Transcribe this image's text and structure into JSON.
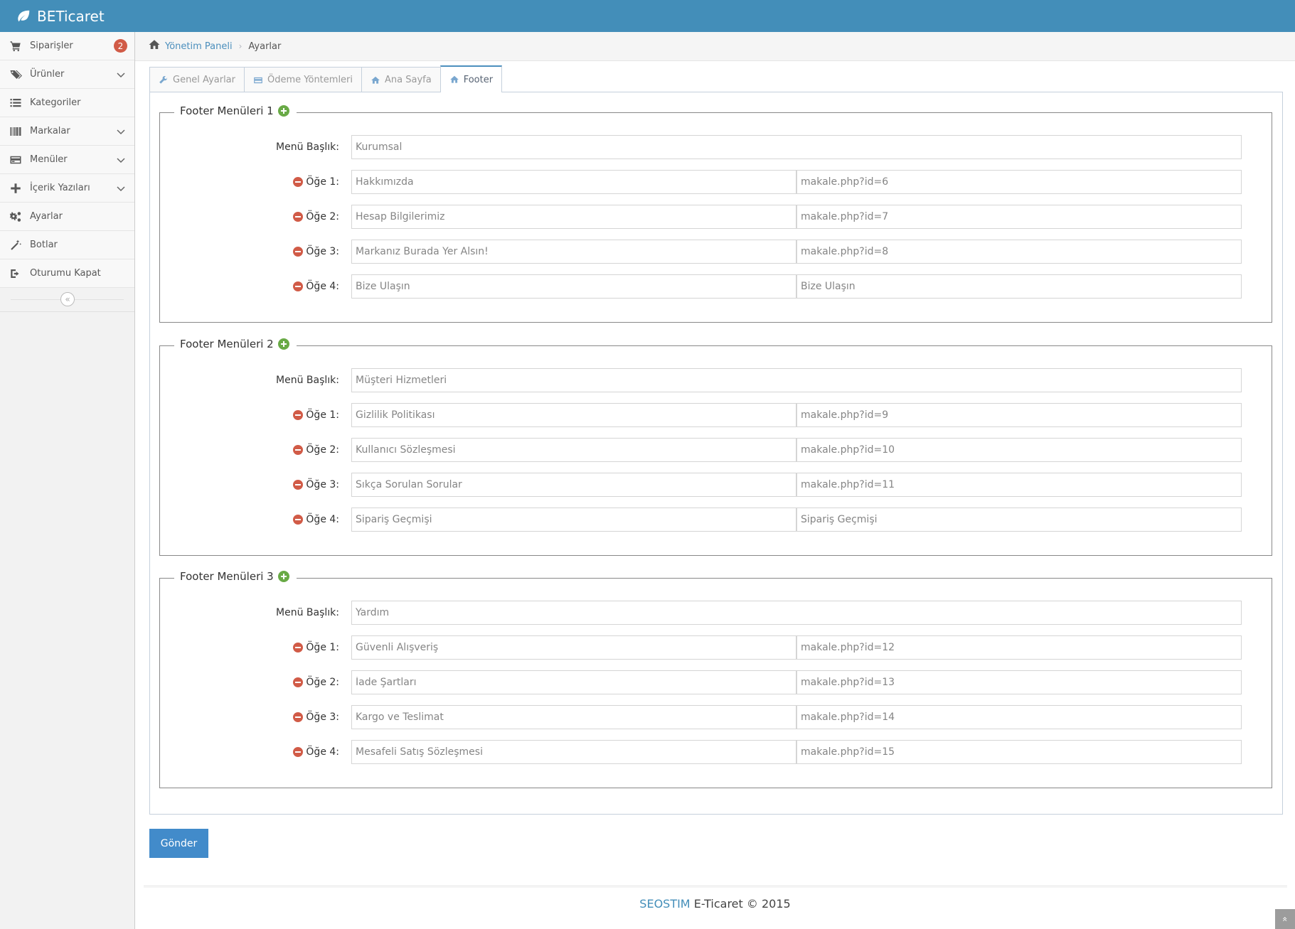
{
  "app": {
    "brand": "BETicaret"
  },
  "sidebar": {
    "items": [
      {
        "label": "Siparişler",
        "icon": "shopping-cart-icon",
        "badge": "2"
      },
      {
        "label": "Ürünler",
        "icon": "tags-icon",
        "has_submenu": true
      },
      {
        "label": "Kategoriler",
        "icon": "list-icon"
      },
      {
        "label": "Markalar",
        "icon": "barcode-icon",
        "has_submenu": true
      },
      {
        "label": "Menüler",
        "icon": "credit-card-icon",
        "has_submenu": true
      },
      {
        "label": "İçerik Yazıları",
        "icon": "plus-icon",
        "has_submenu": true
      },
      {
        "label": "Ayarlar",
        "icon": "cogs-icon"
      },
      {
        "label": "Botlar",
        "icon": "magic-wand-icon"
      },
      {
        "label": "Oturumu Kapat",
        "icon": "sign-out-icon"
      }
    ],
    "collapse_glyph": "«"
  },
  "breadcrumb": {
    "home": "Yönetim Paneli",
    "current": "Ayarlar",
    "separator": "›"
  },
  "tabs": [
    {
      "label": "Genel Ayarlar",
      "icon": "wrench-icon"
    },
    {
      "label": "Ödeme Yöntemleri",
      "icon": "credit-card-icon"
    },
    {
      "label": "Ana Sayfa",
      "icon": "home-icon"
    },
    {
      "label": "Footer",
      "icon": "home-icon",
      "active": true
    }
  ],
  "menus": [
    {
      "legend": "Footer Menüleri 1",
      "title_label": "Menü Başlık:",
      "title_value": "Kurumsal",
      "items": [
        {
          "label": "Öğe 1:",
          "name": "Hakkımızda",
          "link": "makale.php?id=6"
        },
        {
          "label": "Öğe 2:",
          "name": "Hesap Bilgilerimiz",
          "link": "makale.php?id=7"
        },
        {
          "label": "Öğe 3:",
          "name": "Markanız Burada Yer Alsın!",
          "link": "makale.php?id=8"
        },
        {
          "label": "Öğe 4:",
          "name": "Bize Ulaşın",
          "link": "Bize Ulaşın"
        }
      ]
    },
    {
      "legend": "Footer Menüleri 2",
      "title_label": "Menü Başlık:",
      "title_value": "Müşteri Hizmetleri",
      "items": [
        {
          "label": "Öğe 1:",
          "name": "Gizlilik Politikası",
          "link": "makale.php?id=9"
        },
        {
          "label": "Öğe 2:",
          "name": "Kullanıcı Sözleşmesi",
          "link": "makale.php?id=10"
        },
        {
          "label": "Öğe 3:",
          "name": "Sıkça Sorulan Sorular",
          "link": "makale.php?id=11"
        },
        {
          "label": "Öğe 4:",
          "name": "Sipariş Geçmişi",
          "link": "Sipariş Geçmişi"
        }
      ]
    },
    {
      "legend": "Footer Menüleri 3",
      "title_label": "Menü Başlık:",
      "title_value": "Yardım",
      "items": [
        {
          "label": "Öğe 1:",
          "name": "Güvenli Alışveriş",
          "link": "makale.php?id=12"
        },
        {
          "label": "Öğe 2:",
          "name": "İade Şartları",
          "link": "makale.php?id=13"
        },
        {
          "label": "Öğe 3:",
          "name": "Kargo ve Teslimat",
          "link": "makale.php?id=14"
        },
        {
          "label": "Öğe 4:",
          "name": "Mesafeli Satış Sözleşmesi",
          "link": "makale.php?id=15"
        }
      ]
    }
  ],
  "submit_label": "Gönder",
  "footer": {
    "brand": "SEOSTIM",
    "text": "E-Ticaret © 2015"
  },
  "scroll_top_glyph": "«",
  "colors": {
    "navbar": "#438eb9",
    "accent": "#428bca",
    "badge": "#d15b47",
    "add": "#69aa46",
    "remove": "#d15b47"
  }
}
